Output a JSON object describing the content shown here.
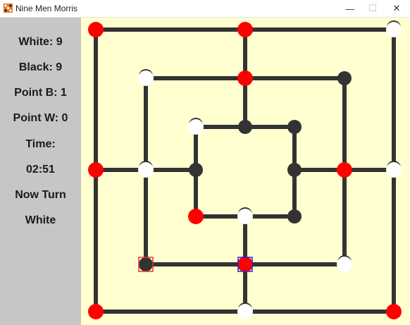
{
  "window": {
    "title": "Nine Men Morris",
    "minimize_glyph": "—",
    "maximize_glyph": "☐",
    "close_glyph": "✕"
  },
  "sidebar": {
    "white_count": "White: 9",
    "black_count": "Black: 9",
    "point_b": "Point B: 1",
    "point_w": "Point W: 0",
    "time_label": "Time:",
    "time_value": "02:51",
    "turn_label": "Now Turn",
    "turn_value": "White"
  },
  "colors": {
    "board_bg": "#ffffd0",
    "line": "#333333",
    "red_piece": "#ff0000",
    "white_piece": "#ffffff",
    "empty_point": "#333333",
    "highlight_red": "#e53030",
    "highlight_blue": "#2020e0"
  },
  "board": {
    "points": [
      {
        "id": "a1",
        "state": "red"
      },
      {
        "id": "a2",
        "state": "red"
      },
      {
        "id": "a3",
        "state": "white"
      },
      {
        "id": "b1",
        "state": "white"
      },
      {
        "id": "b2",
        "state": "red"
      },
      {
        "id": "b3",
        "state": "empty"
      },
      {
        "id": "c1",
        "state": "white"
      },
      {
        "id": "c2",
        "state": "empty"
      },
      {
        "id": "c3",
        "state": "empty"
      },
      {
        "id": "d1",
        "state": "red"
      },
      {
        "id": "d2",
        "state": "white"
      },
      {
        "id": "d3",
        "state": "empty"
      },
      {
        "id": "d4",
        "state": "empty"
      },
      {
        "id": "d5",
        "state": "red"
      },
      {
        "id": "d6",
        "state": "white"
      },
      {
        "id": "e1",
        "state": "red"
      },
      {
        "id": "e2",
        "state": "white"
      },
      {
        "id": "e3",
        "state": "empty"
      },
      {
        "id": "f1",
        "state": "empty",
        "highlight": "red"
      },
      {
        "id": "f2",
        "state": "red",
        "highlight": "blue"
      },
      {
        "id": "f3",
        "state": "white"
      },
      {
        "id": "g1",
        "state": "red"
      },
      {
        "id": "g2",
        "state": "white"
      },
      {
        "id": "g3",
        "state": "red"
      }
    ]
  }
}
